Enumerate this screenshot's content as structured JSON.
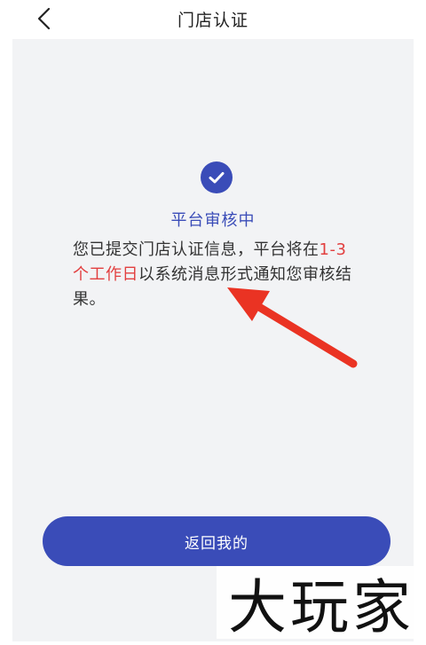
{
  "header": {
    "title": "门店认证",
    "back_icon": "chevron-left-icon"
  },
  "status": {
    "icon": "check-circle-icon",
    "icon_color": "#3a4cb8",
    "title": "平台审核中",
    "message_before": "您已提交门店认证信息，平台将在",
    "message_highlight": "1-3个工作日",
    "message_after": "以系统消息形式通知您审核结果。",
    "highlight_color": "#e23f3f"
  },
  "annotation": {
    "icon": "red-arrow-icon",
    "color": "#ea3323"
  },
  "actions": {
    "return_label": "返回我的",
    "accent_color": "#3a4cb8"
  },
  "watermark": {
    "text": "大玩家"
  }
}
